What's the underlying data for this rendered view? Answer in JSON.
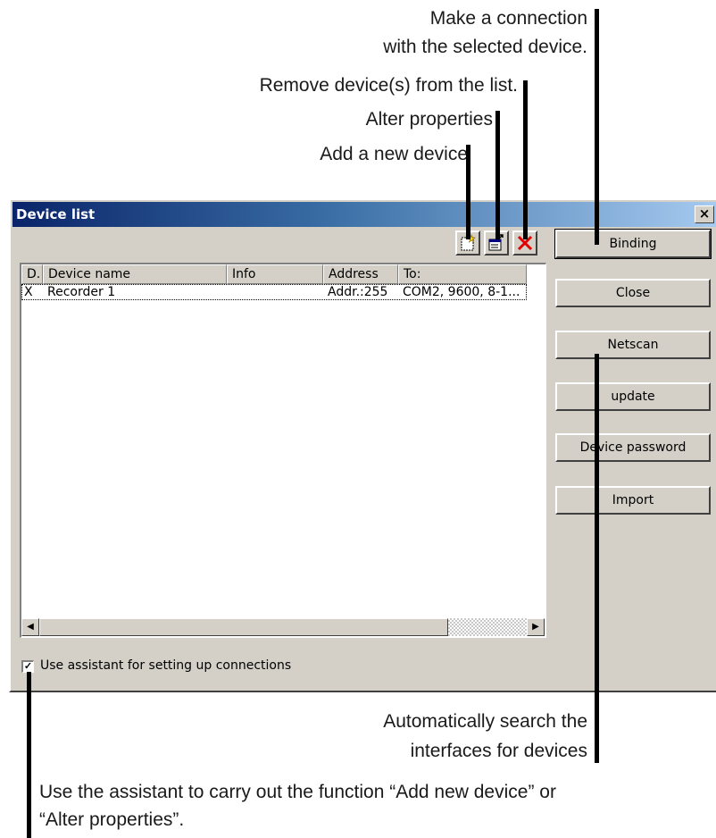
{
  "annotations": {
    "connection_line1": "Make a connection",
    "connection_line2": "with the selected device.",
    "remove": "Remove device(s) from the list.",
    "alter": "Alter properties",
    "add": "Add a new device",
    "netscan_line1": "Automatically search the",
    "netscan_line2": "interfaces for devices",
    "assistant_line1": "Use the assistant to carry out the function “Add new device” or",
    "assistant_line2": "“Alter properties”."
  },
  "dialog": {
    "title": "Device list",
    "close_glyph": "×"
  },
  "toolbar": {
    "icons": [
      "add-device-icon",
      "properties-icon",
      "delete-icon"
    ]
  },
  "table": {
    "columns": [
      "D.",
      "Device name",
      "Info",
      "Address",
      "To:"
    ],
    "rows": [
      {
        "d": "X",
        "name": "Recorder 1",
        "info": "",
        "address": "Addr.:255",
        "to": "COM2, 9600, 8-1..."
      }
    ]
  },
  "buttons": {
    "binding": "Binding",
    "close": "Close",
    "netscan": "Netscan",
    "update": "update",
    "device_password": "Device password",
    "import": "Import"
  },
  "assistant_checkbox": {
    "checked": true,
    "mark": "✓",
    "label": "Use assistant for setting up connections"
  },
  "scrollbar": {
    "left_arrow": "◀",
    "right_arrow": "▶"
  },
  "colors": {
    "dialog_face": "#d4d0c8",
    "title_start": "#0a246a",
    "title_end": "#a6caf0",
    "delete_red": "#e00000"
  }
}
